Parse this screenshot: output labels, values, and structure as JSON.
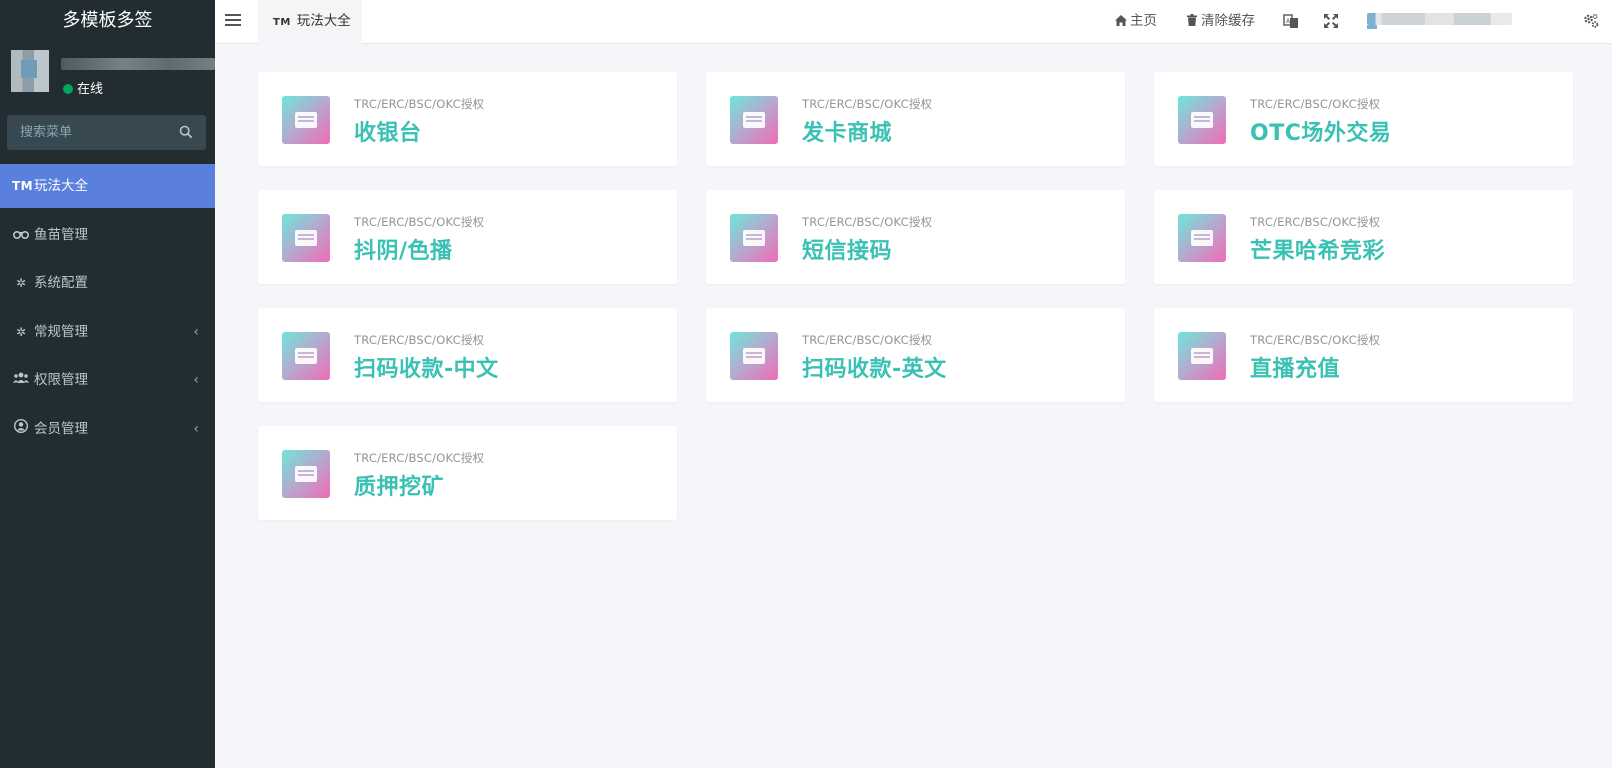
{
  "sidebar": {
    "brand": "多模板多签",
    "status": "在线",
    "search_placeholder": "搜索菜单",
    "items": [
      {
        "label": "玩法大全",
        "icon": "TM"
      },
      {
        "label": "鱼苗管理",
        "icon": "binoculars-icon"
      },
      {
        "label": "系统配置",
        "icon": "gear-icon"
      },
      {
        "label": "常规管理",
        "icon": "gears-icon"
      },
      {
        "label": "权限管理",
        "icon": "users-icon"
      },
      {
        "label": "会员管理",
        "icon": "user-circle-icon"
      }
    ]
  },
  "topbar": {
    "tab_icon": "TM",
    "tab_label": "玩法大全",
    "home_label": "主页",
    "clear_cache_label": "清除缓存"
  },
  "cards": [
    {
      "subtitle": "TRC/ERC/BSC/OKC授权",
      "title": "收银台"
    },
    {
      "subtitle": "TRC/ERC/BSC/OKC授权",
      "title": "发卡商城"
    },
    {
      "subtitle": "TRC/ERC/BSC/OKC授权",
      "title": "OTC场外交易"
    },
    {
      "subtitle": "TRC/ERC/BSC/OKC授权",
      "title": "抖阴/色播"
    },
    {
      "subtitle": "TRC/ERC/BSC/OKC授权",
      "title": "短信接码"
    },
    {
      "subtitle": "TRC/ERC/BSC/OKC授权",
      "title": "芒果哈希竞彩"
    },
    {
      "subtitle": "TRC/ERC/BSC/OKC授权",
      "title": "扫码收款-中文"
    },
    {
      "subtitle": "TRC/ERC/BSC/OKC授权",
      "title": "扫码收款-英文"
    },
    {
      "subtitle": "TRC/ERC/BSC/OKC授权",
      "title": "直播充值"
    },
    {
      "subtitle": "TRC/ERC/BSC/OKC授权",
      "title": "质押挖矿"
    }
  ],
  "colors": {
    "sidebar_bg": "#222d32",
    "active_item": "#5a7fdc",
    "card_title": "#39c1b3",
    "online_dot": "#00a65a"
  }
}
